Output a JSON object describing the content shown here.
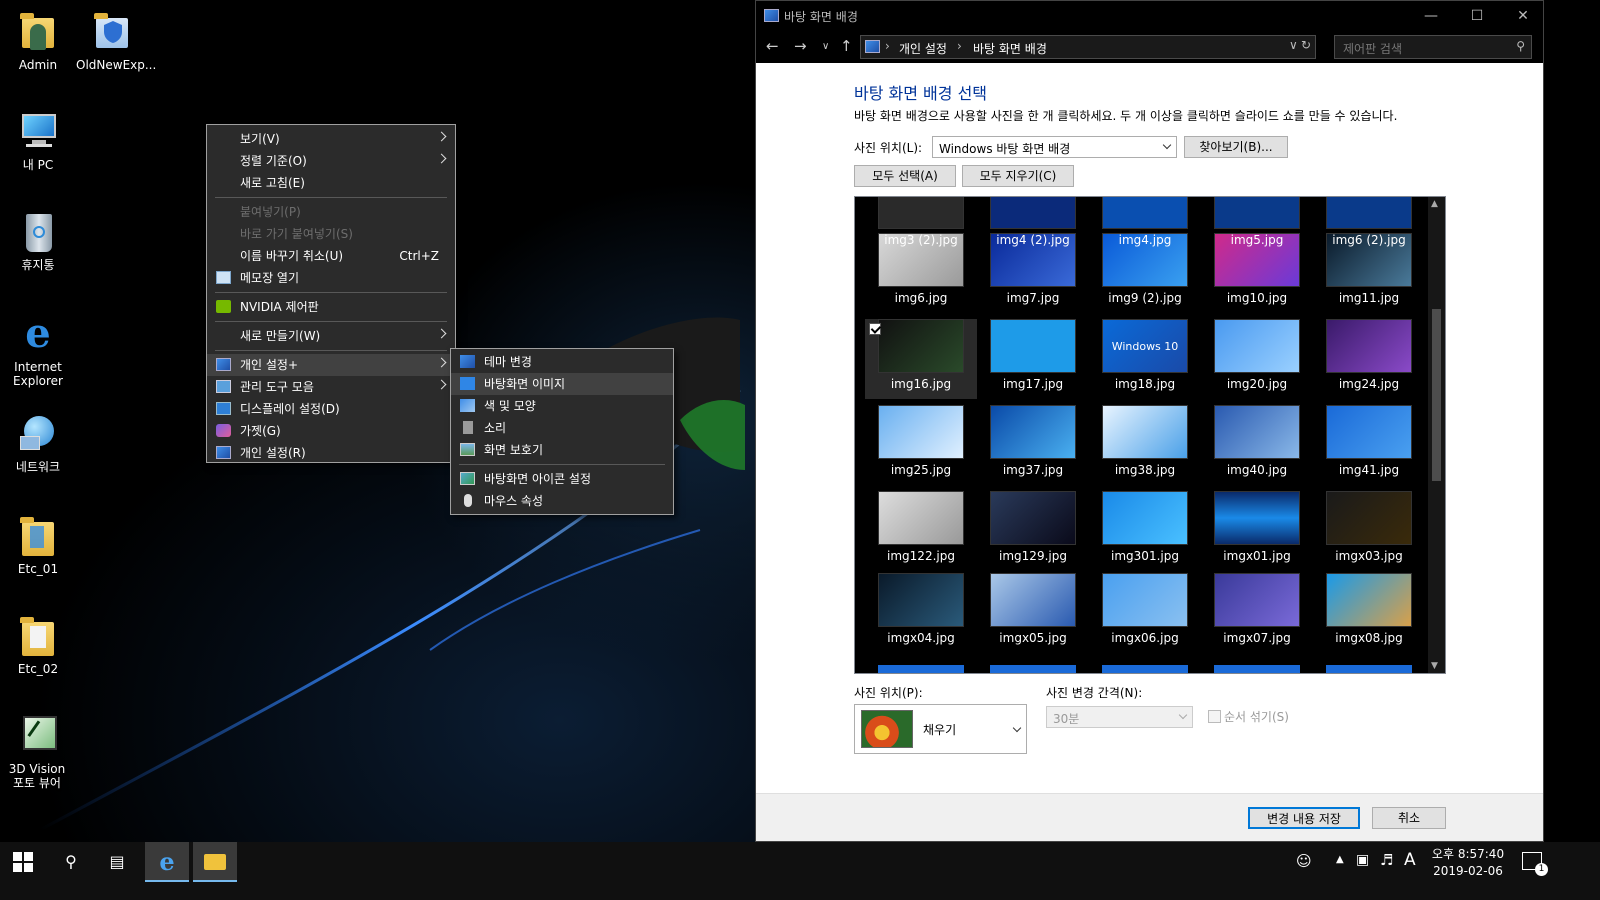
{
  "desktop_icons": [
    {
      "label": "Admin",
      "icon": "user-folder-icon"
    },
    {
      "label": "OldNewExp...",
      "icon": "shield-shortcut-icon"
    },
    {
      "label": "내 PC",
      "icon": "computer-icon"
    },
    {
      "label": "휴지통",
      "icon": "recycle-bin-icon"
    },
    {
      "label": "Internet Explorer",
      "icon": "internet-explorer-icon"
    },
    {
      "label": "네트워크",
      "icon": "network-icon"
    },
    {
      "label": "Etc_01",
      "icon": "folder-icon"
    },
    {
      "label": "Etc_02",
      "icon": "folder-icon"
    },
    {
      "label": "3D Vision 포토 뷰어",
      "icon": "3d-vision-icon"
    }
  ],
  "context_menu": {
    "items": [
      {
        "label": "보기(V)",
        "submenu": true
      },
      {
        "label": "정렬 기준(O)",
        "submenu": true
      },
      {
        "label": "새로 고침(E)"
      },
      {
        "label": "붙여넣기(P)",
        "disabled": true
      },
      {
        "label": "바로 가기 붙여넣기(S)",
        "disabled": true
      },
      {
        "label": "이름 바꾸기 취소(U)",
        "shortcut": "Ctrl+Z"
      },
      {
        "label": "메모장 열기",
        "icon": "notepad-icon"
      },
      {
        "label": "NVIDIA 제어판",
        "icon": "nvidia-icon"
      },
      {
        "label": "새로 만들기(W)",
        "submenu": true
      },
      {
        "label": "개인 설정+",
        "submenu": true,
        "icon": "personalize-icon",
        "highlighted": true
      },
      {
        "label": "관리 도구 모음",
        "submenu": true,
        "icon": "admin-tools-icon"
      },
      {
        "label": "디스플레이 설정(D)",
        "icon": "display-icon"
      },
      {
        "label": "가젯(G)",
        "icon": "gadget-icon"
      },
      {
        "label": "개인 설정(R)",
        "icon": "personalize-icon"
      }
    ]
  },
  "submenu": {
    "items": [
      {
        "label": "테마 변경",
        "icon": "theme-icon"
      },
      {
        "label": "바탕화면 이미지",
        "icon": "desktop-background-icon",
        "highlighted": true
      },
      {
        "label": "색 및 모양",
        "icon": "color-icon"
      },
      {
        "label": "소리",
        "icon": "sound-icon"
      },
      {
        "label": "화면 보호기",
        "icon": "screensaver-icon"
      },
      {
        "label": "바탕화면 아이콘 설정",
        "icon": "desktop-icons-icon"
      },
      {
        "label": "마우스 속성",
        "icon": "mouse-icon"
      }
    ]
  },
  "window": {
    "title": "바탕 화면 배경",
    "address": [
      "개인 설정",
      "바탕 화면 배경"
    ],
    "search_placeholder": "제어판 검색",
    "heading": "바탕 화면 배경 선택",
    "description": "바탕 화면 배경으로 사용할 사진을 한 개 클릭하세요. 두 개 이상을 클릭하면 슬라이드 쇼를 만들 수 있습니다.",
    "location_label": "사진 위치(L):",
    "location_value": "Windows 바탕 화면 배경",
    "browse_button": "찾아보기(B)...",
    "select_all_button": "모두 선택(A)",
    "clear_all_button": "모두 지우기(C)",
    "position_label": "사진 위치(P):",
    "position_value": "채우기",
    "interval_label": "사진 변경 간격(N):",
    "interval_value": "30분",
    "shuffle_label": "순서 섞기(S)",
    "save_button": "변경 내용 저장",
    "cancel_button": "취소"
  },
  "images": [
    [
      "img3 (2).jpg",
      "img4 (2).jpg",
      "img4.jpg",
      "img5.jpg",
      "img6 (2).jpg"
    ],
    [
      "img6.jpg",
      "img7.jpg",
      "img9 (2).jpg",
      "img10.jpg",
      "img11.jpg"
    ],
    [
      "img16.jpg",
      "img17.jpg",
      "img18.jpg",
      "img20.jpg",
      "img24.jpg"
    ],
    [
      "img25.jpg",
      "img37.jpg",
      "img38.jpg",
      "img40.jpg",
      "img41.jpg"
    ],
    [
      "img122.jpg",
      "img129.jpg",
      "img301.jpg",
      "imgx01.jpg",
      "imgx03.jpg"
    ],
    [
      "imgx04.jpg",
      "imgx05.jpg",
      "imgx06.jpg",
      "imgx07.jpg",
      "imgx08.jpg"
    ]
  ],
  "selected_image": "img16.jpg",
  "thumb_text": {
    "img18": "Windows 10"
  },
  "taskbar": {
    "time": "오후 8:57:40",
    "date": "2019-02-06",
    "ime": "A",
    "notification_count": "1"
  }
}
